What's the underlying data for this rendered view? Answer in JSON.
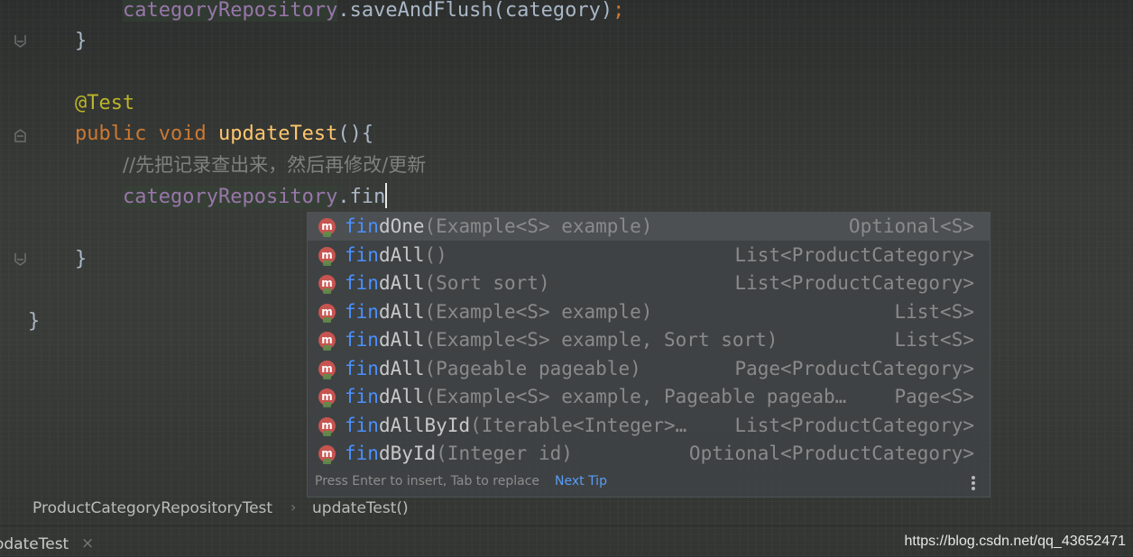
{
  "editor": {
    "line1": {
      "receiver": "categoryRepository",
      "rest": ".saveAndFlush(category)",
      "semi": ";"
    },
    "close_brace_1": "}",
    "annotation": "@Test",
    "line_method": {
      "kw1": "public",
      "kw2": "void",
      "name": "updateTest",
      "rest": "(){"
    },
    "comment": "//先把记录查出来，然后再修改/更新",
    "line_typing": {
      "receiver": "categoryRepository",
      "typed": ".fin"
    },
    "close_brace_2": "}",
    "close_brace_3": "}"
  },
  "completion": {
    "match": "fin",
    "items": [
      {
        "name_rest": "dOne",
        "params": "(Example<S> example)",
        "return_type": "Optional<S>",
        "selected": true
      },
      {
        "name_rest": "dAll",
        "params": "()",
        "return_type": "List<ProductCategory>"
      },
      {
        "name_rest": "dAll",
        "params": "(Sort sort)",
        "return_type": "List<ProductCategory>"
      },
      {
        "name_rest": "dAll",
        "params": "(Example<S> example)",
        "return_type": "List<S>"
      },
      {
        "name_rest": "dAll",
        "params": "(Example<S> example, Sort sort)",
        "return_type": "List<S>"
      },
      {
        "name_rest": "dAll",
        "params": "(Pageable pageable)",
        "return_type": "Page<ProductCategory>"
      },
      {
        "name_rest": "dAll",
        "params": "(Example<S> example, Pageable pageab…",
        "return_type": "Page<S>"
      },
      {
        "name_rest": "dAllById",
        "params": "(Iterable<Integer>…",
        "return_type": "List<ProductCategory>"
      },
      {
        "name_rest": "dById",
        "params": "(Integer id)",
        "return_type": "Optional<ProductCategory>"
      }
    ],
    "icon_letter": "m",
    "hint": "Press Enter to insert, Tab to replace",
    "next_tip": "Next Tip"
  },
  "breadcrumb": {
    "file": "ProductCategoryRepositoryTest",
    "separator": "›",
    "method": "updateTest()"
  },
  "tab": {
    "label": "odateTest",
    "close": "×"
  },
  "watermark": "https://blog.csdn.net/qq_43652471",
  "colors": {
    "keyword": "#cc7832",
    "annotation": "#bbb529",
    "method": "#ffc66d",
    "field": "#9876aa",
    "match": "#4a90ff"
  }
}
